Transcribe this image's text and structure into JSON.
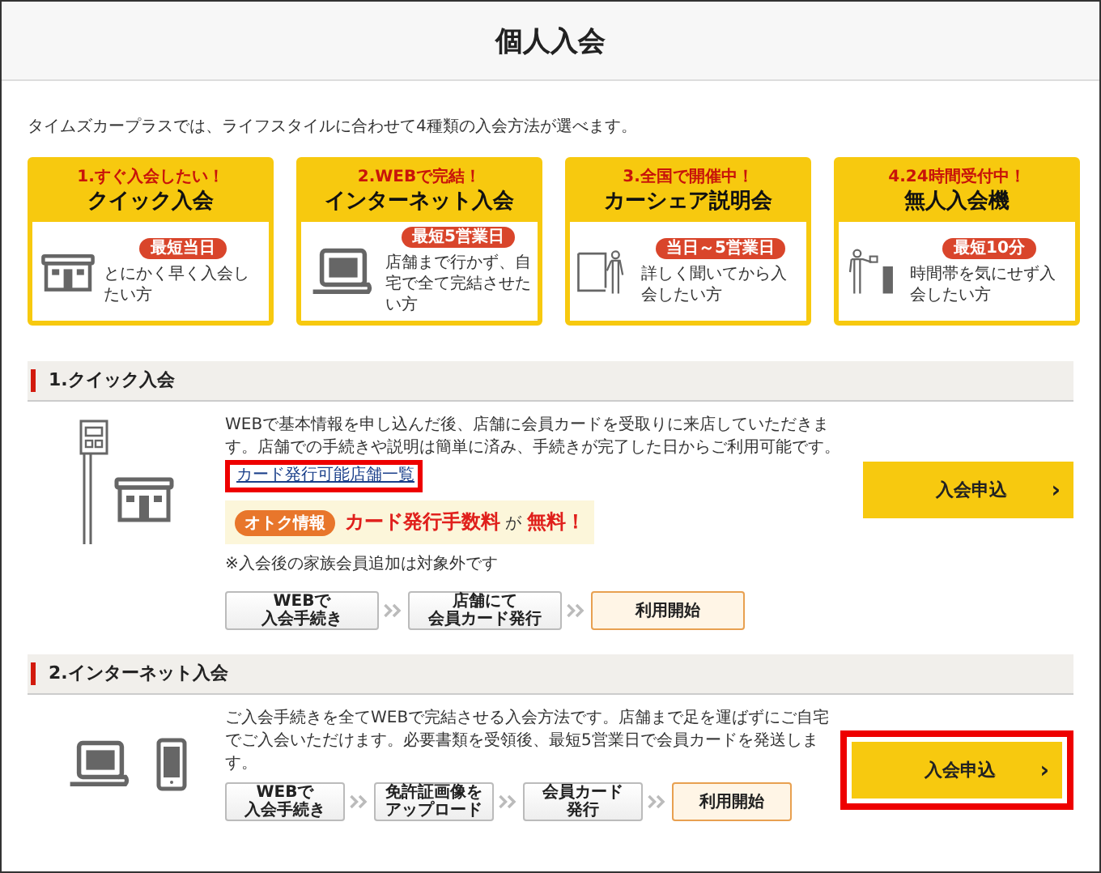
{
  "page": {
    "title": "個人入会",
    "intro": "タイムズカープラスでは、ライフスタイルに合わせて4種類の入会方法が選べます。"
  },
  "cards": [
    {
      "number": "1.すぐ入会したい！",
      "title": "クイック入会",
      "badge": "最短当日",
      "description": "とにかく早く入会したい方"
    },
    {
      "number": "2.WEBで完結！",
      "title": "インターネット入会",
      "badge": "最短5営業日",
      "description": "店舗まで行かず、自宅で全て完結させたい方"
    },
    {
      "number": "3.全国で開催中！",
      "title": "カーシェア説明会",
      "badge": "当日～5営業日",
      "description": "詳しく聞いてから入会したい方"
    },
    {
      "number": "4.24時間受付中！",
      "title": "無人入会機",
      "badge": "最短10分",
      "description": "時間帯を気にせず入会したい方"
    }
  ],
  "sections": [
    {
      "heading": "1.クイック入会",
      "description": "WEBで基本情報を申し込んだ後、店舗に会員カードを受取りに来店していただきます。店舗での手続きや説明は簡単に済み、手続きが完了した日からご利用可能です。",
      "link": {
        "label": "カード発行可能店舗一覧",
        "highlighted": true
      },
      "promo": {
        "tag": "オトク情報",
        "text": "**カード発行手数料** が **無料！**"
      },
      "note": "※入会後の家族会員追加は対象外です",
      "steps": [
        {
          "lines": [
            "WEBで",
            "入会手続き"
          ],
          "kind": "step"
        },
        {
          "lines": [
            "店舗にて",
            "会員カード発行"
          ],
          "kind": "step"
        },
        {
          "lines": [
            "利用開始"
          ],
          "kind": "goal"
        }
      ],
      "button": {
        "label": "入会申込",
        "arrow": "›",
        "highlighted": false
      }
    },
    {
      "heading": "2.インターネット入会",
      "description": "ご入会手続きを全てWEBで完結させる入会方法です。店舗まで足を運ばずにご自宅でご入会いただけます。必要書類を受領後、最短5営業日で会員カードを発送します。",
      "steps": [
        {
          "lines": [
            "WEBで",
            "入会手続き"
          ],
          "kind": "step"
        },
        {
          "lines": [
            "免許証画像を",
            "アップロード"
          ],
          "kind": "step"
        },
        {
          "lines": [
            "会員カード",
            "発行"
          ],
          "kind": "step"
        },
        {
          "lines": [
            "利用開始"
          ],
          "kind": "goal"
        }
      ],
      "button": {
        "label": "入会申込",
        "arrow": "›",
        "highlighted": true
      }
    }
  ]
}
